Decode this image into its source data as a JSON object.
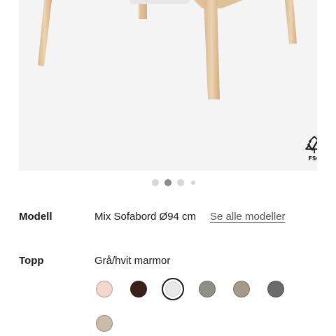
{
  "gallery": {
    "dot_count": 4,
    "active_index": 1,
    "fsc_label": "FSC"
  },
  "model": {
    "label": "Modell",
    "value": "Mix Sofabord Ø94 cm",
    "link": "Se alle modeller"
  },
  "top": {
    "label": "Topp",
    "value": "Grå/hvit marmor",
    "selected_index": 2,
    "swatches": [
      {
        "name": "swatch-pink-marble",
        "color": "#f3d8cb"
      },
      {
        "name": "swatch-brown-marble",
        "color": "#3b1f1a"
      },
      {
        "name": "swatch-grey-white-marble",
        "color": "#e8e8e6"
      },
      {
        "name": "swatch-grey-stone",
        "color": "#8f8e87"
      },
      {
        "name": "swatch-taupe-stone",
        "color": "#a7998a"
      },
      {
        "name": "swatch-dark-grey-stone",
        "color": "#6b6b6b"
      },
      {
        "name": "swatch-beige-stone",
        "color": "#c9bda9"
      }
    ]
  }
}
